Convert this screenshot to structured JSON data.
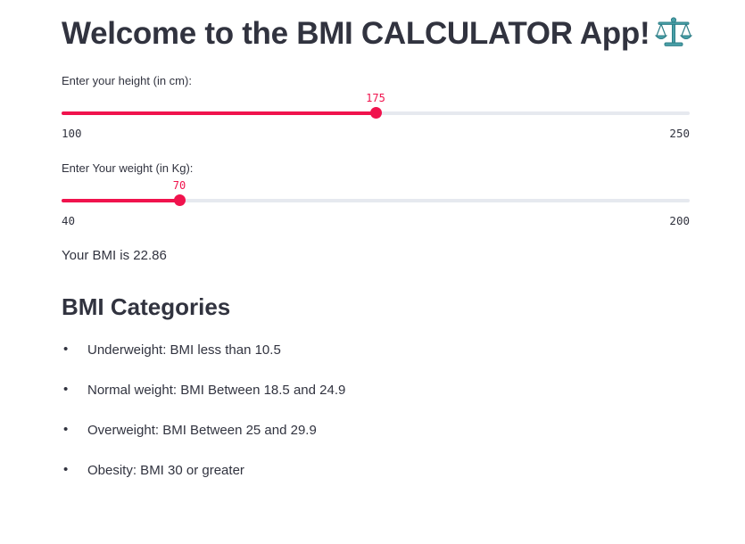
{
  "app": {
    "title": "Welcome to the BMI CALCULATOR App!",
    "title_icon": "balance-scale-icon",
    "accent_color": "#f0134d",
    "track_color": "#e6e9ef",
    "text_color": "#31333f"
  },
  "height_slider": {
    "label": "Enter your height (in cm):",
    "value": "175",
    "min": "100",
    "max": "250"
  },
  "weight_slider": {
    "label": "Enter Your weight (in Kg):",
    "value": "70",
    "min": "40",
    "max": "200"
  },
  "result": {
    "text": "Your BMI is 22.86"
  },
  "categories": {
    "heading": "BMI Categories",
    "bullet": "•",
    "items": [
      "Underweight: BMI less than 10.5",
      "Normal weight: BMI Between 18.5 and 24.9",
      "Overweight: BMI Between 25 and 29.9",
      "Obesity: BMI 30 or greater"
    ]
  }
}
